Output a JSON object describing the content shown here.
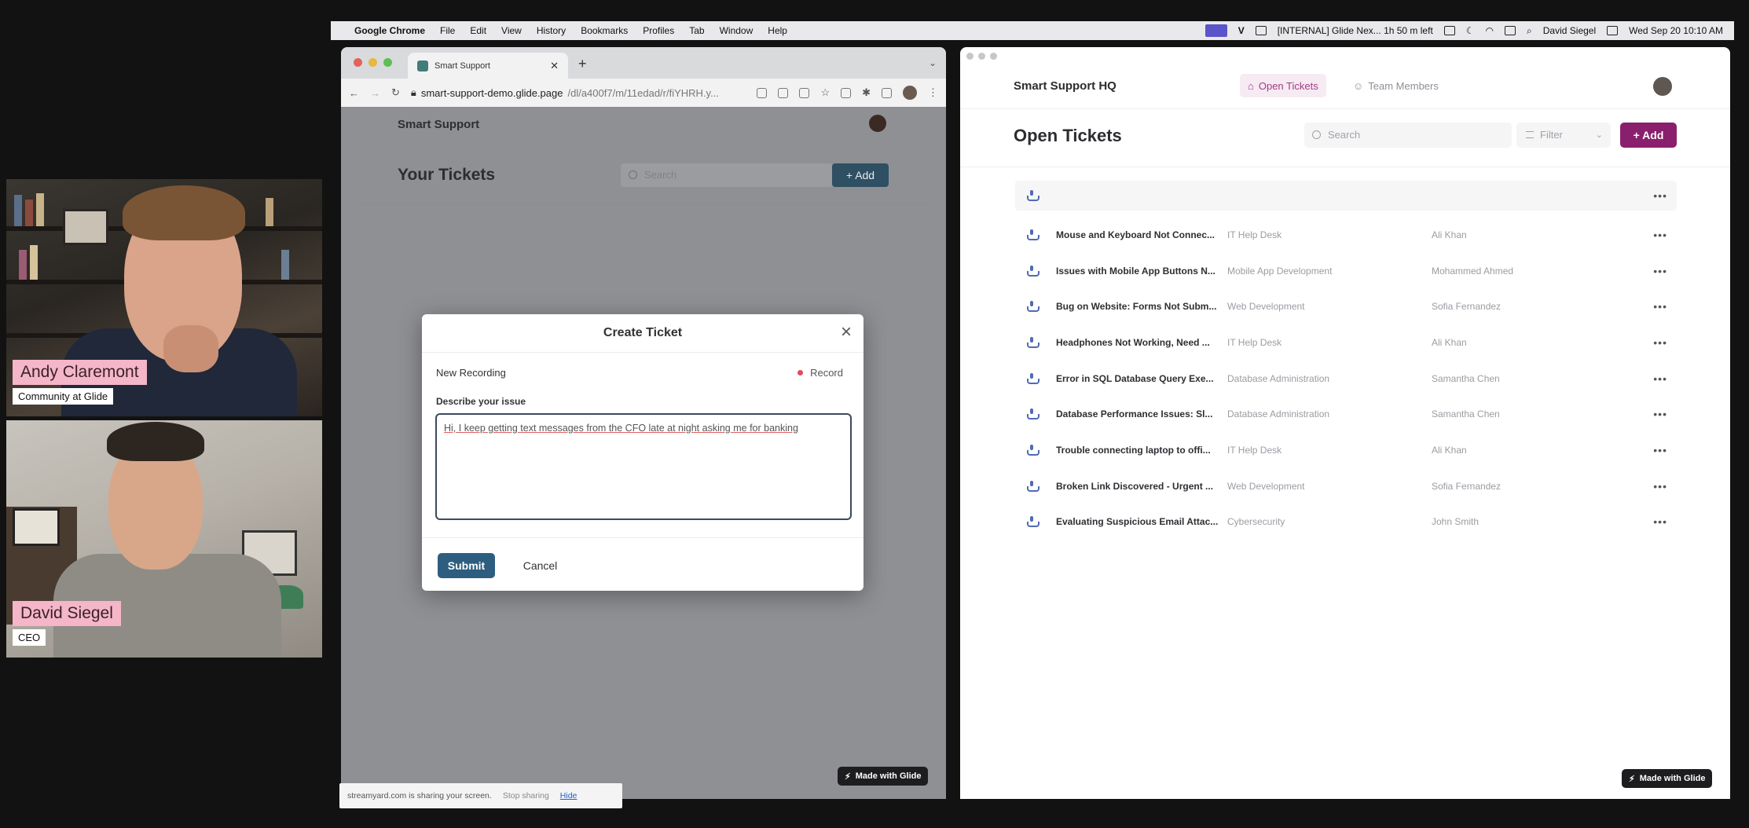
{
  "webcams": [
    {
      "name": "Andy Claremont",
      "role": "Community at Glide"
    },
    {
      "name": "David Siegel",
      "role": "CEO"
    }
  ],
  "menubar": {
    "app": "Google Chrome",
    "items": [
      "File",
      "Edit",
      "View",
      "History",
      "Bookmarks",
      "Profiles",
      "Tab",
      "Window",
      "Help"
    ],
    "status": "[INTERNAL] Glide Nex... 1h 50 m left",
    "user": "David Siegel",
    "datetime": "Wed Sep 20  10:10 AM"
  },
  "left_browser": {
    "tab_title": "Smart Support",
    "url_host": "smart-support-demo.glide.page",
    "url_path": "/dl/a400f7/m/11edad/r/fiYHRH.y...",
    "app": {
      "brand": "Smart Support",
      "heading": "Your Tickets",
      "search_placeholder": "Search",
      "add_label": "Add",
      "made_with": "Made with Glide"
    }
  },
  "modal": {
    "title": "Create Ticket",
    "recording_label": "New Recording",
    "record_label": "Record",
    "describe_label": "Describe your issue",
    "description": "Hi, I keep getting text messages from the CFO late at night asking me for banking",
    "submit_label": "Submit",
    "cancel_label": "Cancel"
  },
  "sharebar": {
    "message": "streamyard.com is sharing your screen.",
    "stop_label": "Stop sharing",
    "hide_label": "Hide"
  },
  "right_app": {
    "brand": "Smart Support HQ",
    "nav": [
      {
        "label": "Open Tickets",
        "active": true
      },
      {
        "label": "Team Members",
        "active": false
      }
    ],
    "heading": "Open Tickets",
    "search_placeholder": "Search",
    "filter_label": "Filter",
    "add_label": "Add",
    "made_with": "Made with Glide",
    "accent": "#8a1f6e",
    "tickets": [
      {
        "title": "Mouse and Keyboard Not Connec...",
        "category": "IT Help Desk",
        "assignee": "Ali Khan"
      },
      {
        "title": "Issues with Mobile App Buttons N...",
        "category": "Mobile App Development",
        "assignee": "Mohammed Ahmed"
      },
      {
        "title": "Bug on Website: Forms Not Subm...",
        "category": "Web Development",
        "assignee": "Sofia Fernandez"
      },
      {
        "title": "Headphones Not Working, Need ...",
        "category": "IT Help Desk",
        "assignee": "Ali Khan"
      },
      {
        "title": "Error in SQL Database Query Exe...",
        "category": "Database Administration",
        "assignee": "Samantha Chen"
      },
      {
        "title": "Database Performance Issues: Sl...",
        "category": "Database Administration",
        "assignee": "Samantha Chen"
      },
      {
        "title": "Trouble connecting laptop to offi...",
        "category": "IT Help Desk",
        "assignee": "Ali Khan"
      },
      {
        "title": "Broken Link Discovered - Urgent ...",
        "category": "Web Development",
        "assignee": "Sofia Fernandez"
      },
      {
        "title": "Evaluating Suspicious Email Attac...",
        "category": "Cybersecurity",
        "assignee": "John Smith"
      }
    ]
  }
}
